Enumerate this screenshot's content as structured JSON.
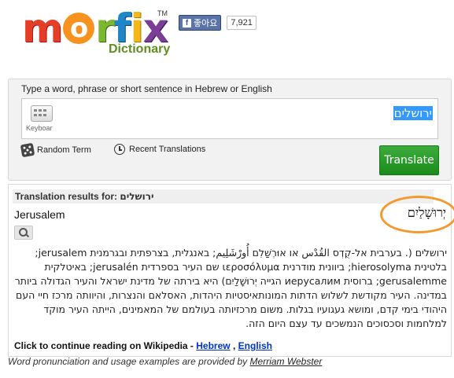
{
  "logo": {
    "brand": [
      "m",
      "o",
      "r",
      "f",
      "i",
      "x"
    ],
    "tm": "TM",
    "subtitle": "Dictionary",
    "colors": {
      "m": "#e53e27",
      "o": "#f7921e",
      "r": "#7cb82f",
      "f": "#1f86c7",
      "i": "#f3b71b",
      "x": "#7a3e97",
      "dictionary": "#5e8f1e"
    }
  },
  "facebook": {
    "icon": "facebook-f-icon",
    "label": "좋아요",
    "count": "7,921"
  },
  "search": {
    "prompt": "Type a word, phrase or short sentence in Hebrew or English",
    "keyboard_label": "Keyboar",
    "value": "ירושלים",
    "random_term": "Random Term",
    "recent_translations": "Recent Translations",
    "translate": "Translate"
  },
  "results": {
    "header_label": "Translation results for:",
    "header_term": "ירושלים",
    "english": "Jerusalem",
    "hebrew": "יְרוּשָׁלַיִם",
    "wiki_text": "ירושלים (. בערבית אל-קֻדְס القُدْس או אוּרְשַׁלִם أُورْشَلِيم; באנגלית, בצרפתית ובגרמנית jerusalem; בלטינית hierosolyma; ביוונית מודרנית ιεροσόλυμα שם העיר בספרדית jerusalén; באיטלקית gerusalemme; ברוסית иерусалим הגייה יְרוּשָׁלַיִם) היא בירתה של מדינת ישראל והעיר הגדולה ביותר במדינה. העיר מקודשת לשלוש הדתות המונותאיסטיות היהדות, האסלאם והנצרות, והיוותה מרכז חיי העם היהודי בימי קדם, ומושא געגועיו בגלות. משום מרכזיותה בעולמם של המאמינים, הייתה העיר מוקד למלחמות וסכסוכים הנמשכים עד עצם היום הזה.",
    "wiki_prefix": "Click to continue reading on Wikipedia -",
    "wiki_hebrew": "Hebrew",
    "wiki_sep": ",",
    "wiki_english": "English"
  },
  "credits": {
    "text": "Word pronunciation and usage examples are provided by",
    "link": "Merriam Webster"
  },
  "accent_colors": {
    "translate_button": "#2a9d2a",
    "highlight_circle": "#f29a2e",
    "selection": "#3399ff"
  }
}
